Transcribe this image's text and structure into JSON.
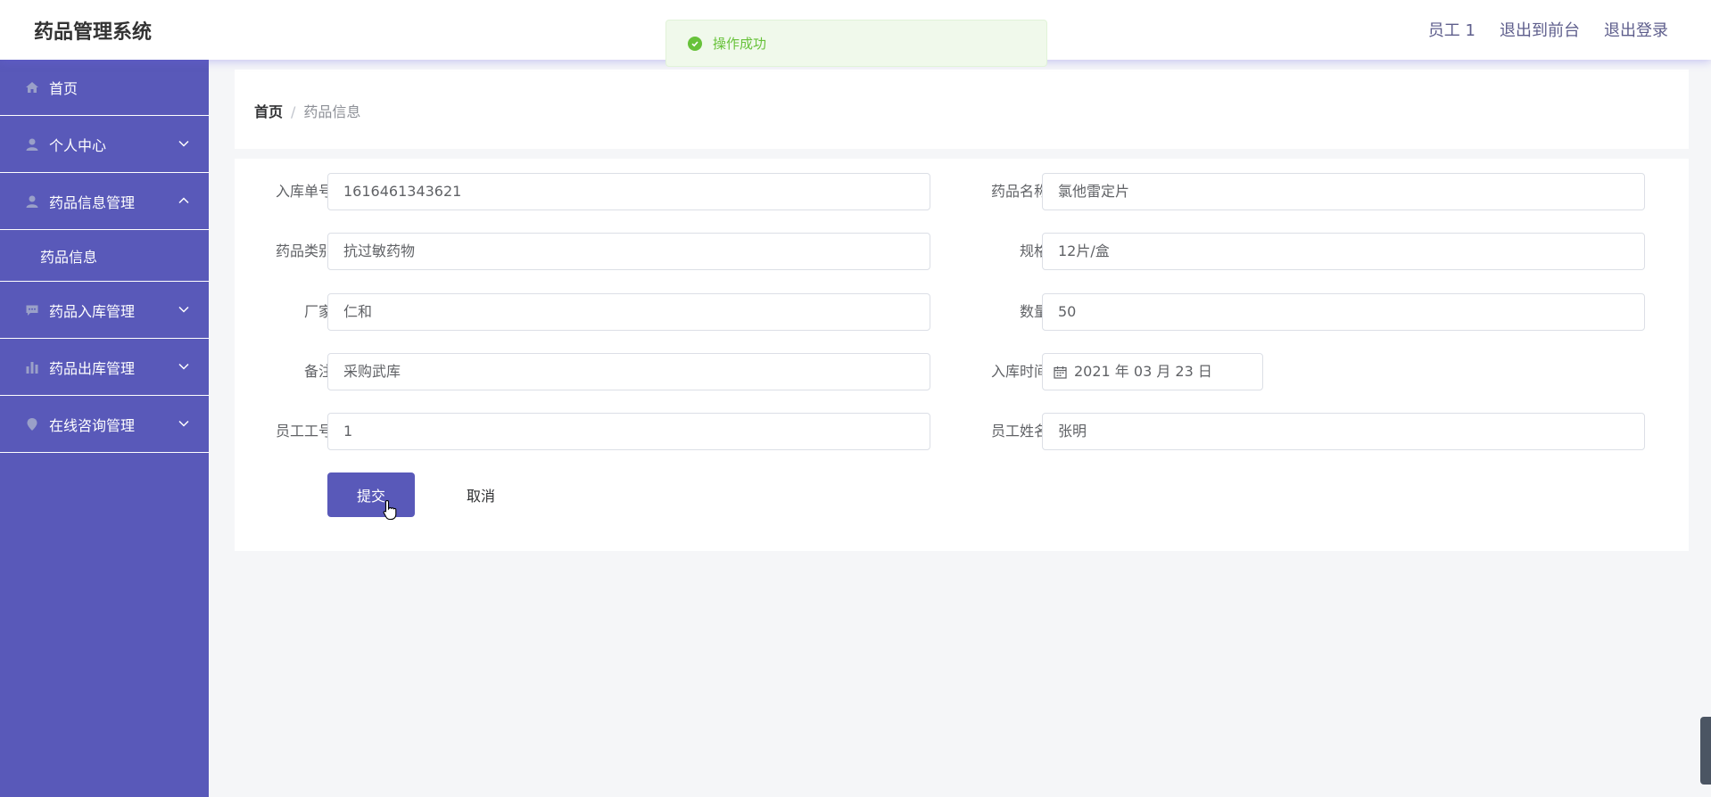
{
  "header": {
    "title": "药品管理系统",
    "user": "员工 1",
    "back_to_front": "退出到前台",
    "logout": "退出登录"
  },
  "toast": {
    "message": "操作成功",
    "color": "#67c23a"
  },
  "sidebar": {
    "background": "#5959b9",
    "items": [
      {
        "label": "首页",
        "icon": "home-icon"
      },
      {
        "label": "个人中心",
        "icon": "user-icon",
        "expanded": false
      },
      {
        "label": "药品信息管理",
        "icon": "user-icon",
        "expanded": true,
        "children": [
          {
            "label": "药品信息"
          }
        ]
      },
      {
        "label": "药品入库管理",
        "icon": "chat-icon",
        "expanded": false
      },
      {
        "label": "药品出库管理",
        "icon": "bar-chart-icon",
        "expanded": false
      },
      {
        "label": "在线咨询管理",
        "icon": "location-icon",
        "expanded": false
      }
    ]
  },
  "breadcrumb": {
    "home": "首页",
    "separator": "/",
    "current": "药品信息"
  },
  "form": {
    "fields": {
      "inbound_no": {
        "label": "入库单号",
        "value": "1616461343621"
      },
      "drug_name": {
        "label": "药品名称",
        "value": "氯他雷定片"
      },
      "category": {
        "label": "药品类别",
        "value": "抗过敏药物"
      },
      "spec": {
        "label": "规格",
        "value": "12片/盒"
      },
      "manufacturer": {
        "label": "厂家",
        "value": "仁和"
      },
      "quantity": {
        "label": "数量",
        "value": "50"
      },
      "remark": {
        "label": "备注",
        "value": "采购武库"
      },
      "inbound_time": {
        "label": "入库时间",
        "value": "2021 年 03 月 23 日"
      },
      "staff_no": {
        "label": "员工工号",
        "value": "1"
      },
      "staff_name": {
        "label": "员工姓名",
        "value": "张明"
      }
    },
    "submit": "提交",
    "cancel": "取消"
  }
}
